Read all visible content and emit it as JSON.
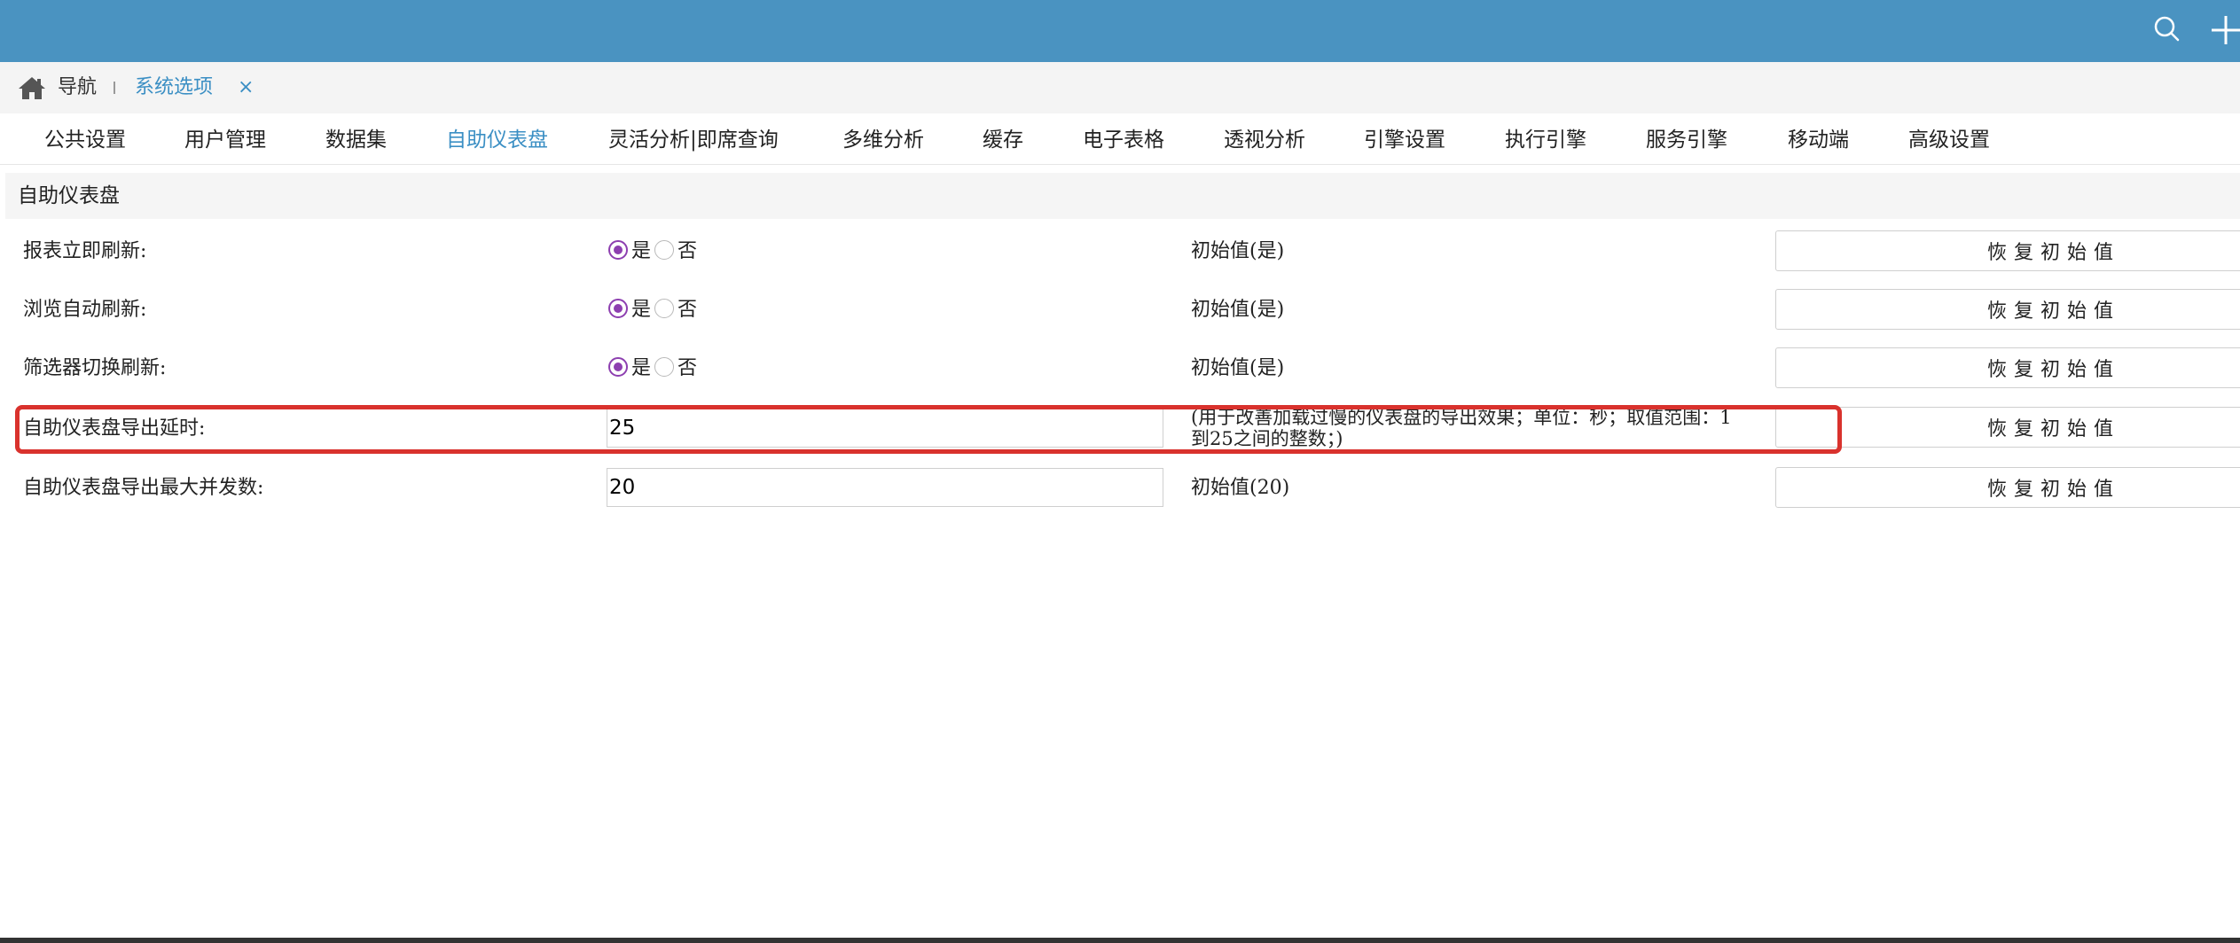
{
  "header": {
    "search_icon": "search-icon",
    "add_icon": "plus-icon",
    "bar_color": "#4a93c1"
  },
  "breadcrumb": {
    "home_icon": "home-icon",
    "nav_label": "导航",
    "current_label": "系统选项",
    "close_label": "×"
  },
  "tabs": [
    {
      "label": "公共设置"
    },
    {
      "label": "用户管理"
    },
    {
      "label": "数据集"
    },
    {
      "label": "自助仪表盘",
      "active": true
    },
    {
      "label": "灵活分析|即席查询"
    },
    {
      "label": "多维分析"
    },
    {
      "label": "缓存"
    },
    {
      "label": "电子表格"
    },
    {
      "label": "透视分析"
    },
    {
      "label": "引擎设置"
    },
    {
      "label": "执行引擎"
    },
    {
      "label": "服务引擎"
    },
    {
      "label": "移动端"
    },
    {
      "label": "高级设置"
    }
  ],
  "section": {
    "title": "自助仪表盘"
  },
  "settings": [
    {
      "label": "报表立即刷新:",
      "yes": "是",
      "no": "否",
      "selected": "是",
      "initial": "初始值(是)",
      "reset": "恢复初始值"
    },
    {
      "label": "浏览自动刷新:",
      "yes": "是",
      "no": "否",
      "selected": "是",
      "initial": "初始值(是)",
      "reset": "恢复初始值"
    },
    {
      "label": "筛选器切换刷新:",
      "yes": "是",
      "no": "否",
      "selected": "是",
      "initial": "初始值(是)",
      "reset": "恢复初始值"
    },
    {
      "label": "自助仪表盘导出延时:",
      "value": "25",
      "hint": "(用于改善加载过慢的仪表盘的导出效果；单位：秒；取值范围：1到25之间的整数；)",
      "reset": "恢复初始值"
    },
    {
      "label": "自助仪表盘导出最大并发数:",
      "value": "20",
      "initial": "初始值(20)",
      "reset": "恢复初始值"
    }
  ],
  "colors": {
    "accent": "#3b8fc4",
    "radio": "#8d3fb0",
    "highlight": "#d9322d"
  }
}
